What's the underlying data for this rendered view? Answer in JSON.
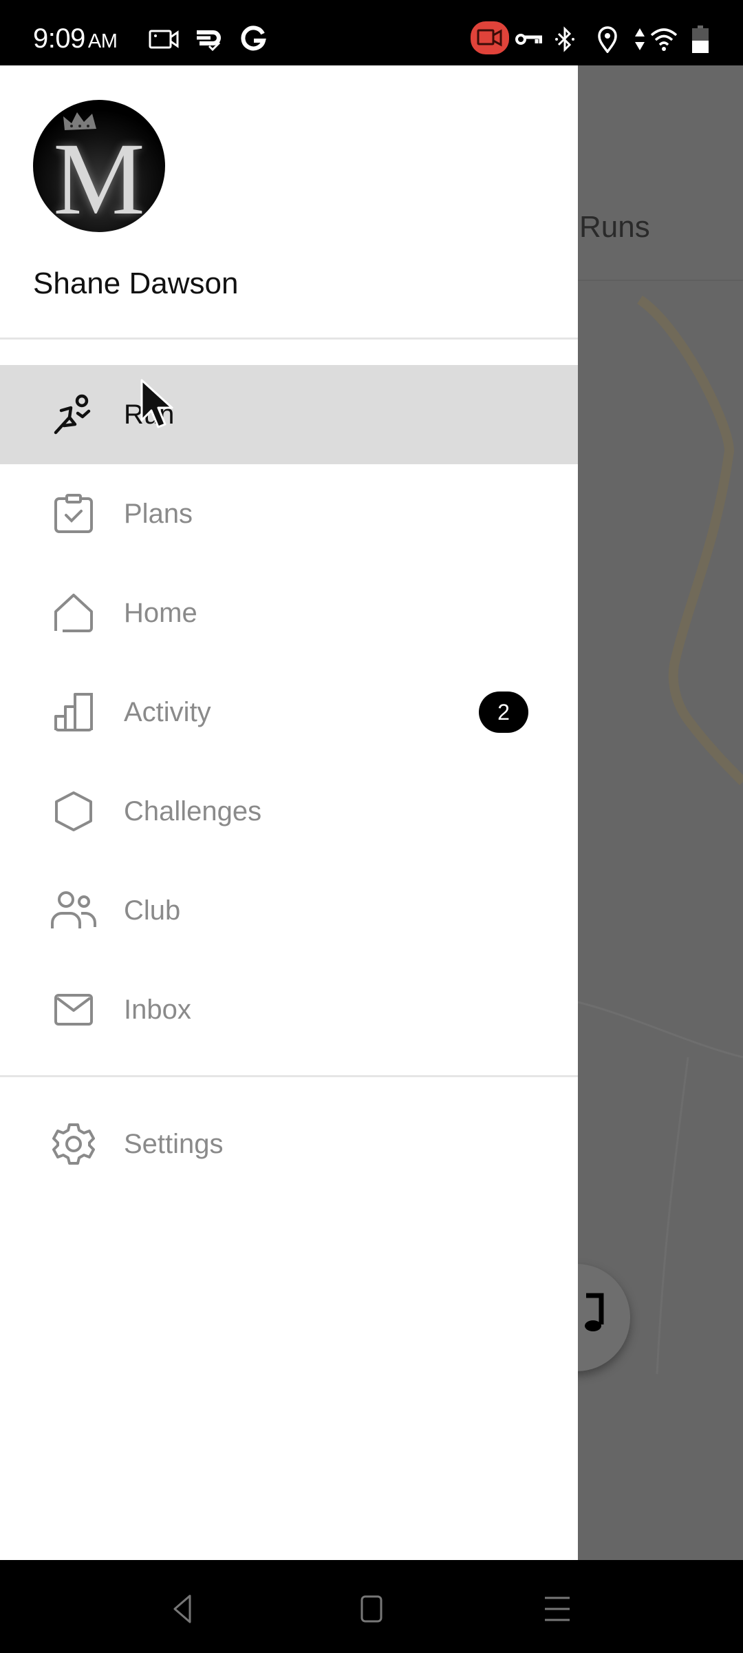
{
  "status_bar": {
    "time": "9:09",
    "ampm": "AM",
    "left_icons": [
      "screen-record-icon",
      "sync-check-icon",
      "google-icon"
    ],
    "right_icons": [
      "recording-active-icon",
      "vpn-key-icon",
      "bluetooth-icon",
      "location-icon",
      "data-arrows-icon",
      "wifi-icon",
      "battery-icon"
    ],
    "recording_color": "#e0433a"
  },
  "background_app": {
    "title": "Runs",
    "fab_icon": "music-note-icon",
    "route_color": "#7a6d4f"
  },
  "drawer": {
    "profile": {
      "name": "Shane Dawson",
      "avatar_monogram": "M"
    },
    "items": [
      {
        "id": "run",
        "label": "Run",
        "icon": "running-icon",
        "active": true
      },
      {
        "id": "plans",
        "label": "Plans",
        "icon": "clipboard-check-icon",
        "active": false
      },
      {
        "id": "home",
        "label": "Home",
        "icon": "home-icon",
        "active": false
      },
      {
        "id": "activity",
        "label": "Activity",
        "icon": "bar-chart-icon",
        "active": false,
        "badge": "2"
      },
      {
        "id": "challenges",
        "label": "Challenges",
        "icon": "hexagon-icon",
        "active": false
      },
      {
        "id": "club",
        "label": "Club",
        "icon": "people-icon",
        "active": false
      },
      {
        "id": "inbox",
        "label": "Inbox",
        "icon": "mail-icon",
        "active": false
      }
    ],
    "footer_items": [
      {
        "id": "settings",
        "label": "Settings",
        "icon": "gear-icon"
      }
    ],
    "active_bg": "#dcdcdc",
    "inactive_color": "#8a8a8a"
  },
  "nav_bar": {
    "buttons": [
      "back",
      "home",
      "recents"
    ]
  }
}
